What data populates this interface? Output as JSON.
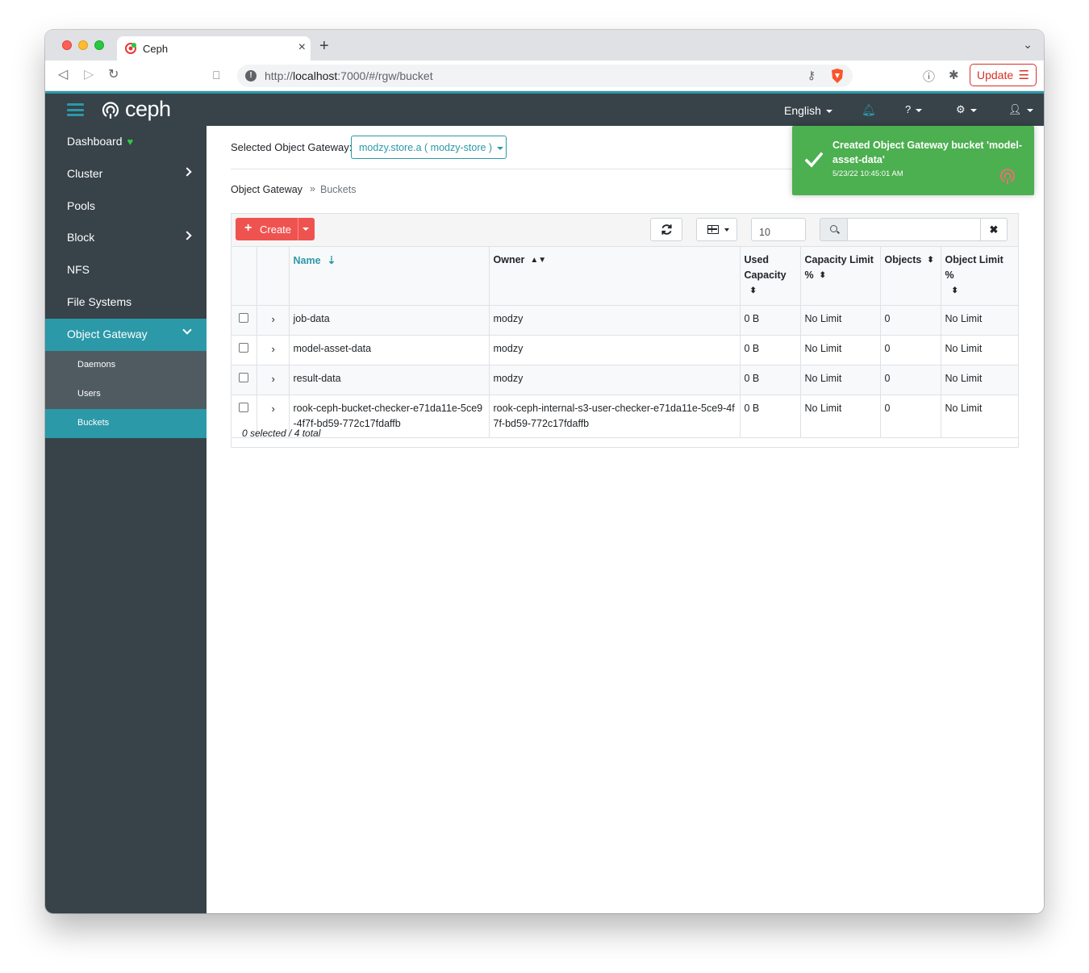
{
  "browser": {
    "tab_title": "Ceph",
    "tab_close": "×",
    "new_tab": "+",
    "tab_menu": "⌄",
    "url_prefix": "http://",
    "url_host": "localhost",
    "url_rest": ":7000/#/rgw/bucket",
    "update_label": "Update"
  },
  "navbar": {
    "brand": "ceph",
    "language": "English"
  },
  "sidebar": {
    "items": [
      {
        "label": "Dashboard"
      },
      {
        "label": "Cluster"
      },
      {
        "label": "Pools"
      },
      {
        "label": "Block"
      },
      {
        "label": "NFS"
      },
      {
        "label": "File Systems"
      },
      {
        "label": "Object Gateway"
      }
    ],
    "sub_items": [
      {
        "label": "Daemons"
      },
      {
        "label": "Users"
      },
      {
        "label": "Buckets"
      }
    ]
  },
  "gateway": {
    "label": "Selected Object Gateway:",
    "selected": "modzy.store.a ( modzy-store )"
  },
  "breadcrumb": {
    "parent": "Object Gateway",
    "separator": "»",
    "current": "Buckets"
  },
  "toolbar": {
    "create_label": "Create",
    "page_size": "10",
    "search_placeholder": "",
    "clear_label": "✖"
  },
  "table": {
    "headers": [
      "Name",
      "Owner",
      "Used Capacity",
      "Capacity Limit %",
      "Objects",
      "Object Limit %"
    ],
    "rows": [
      {
        "name": "job-data",
        "owner": "modzy",
        "used": "0 B",
        "cap_limit": "No Limit",
        "objects": "0",
        "obj_limit": "No Limit"
      },
      {
        "name": "model-asset-data",
        "owner": "modzy",
        "used": "0 B",
        "cap_limit": "No Limit",
        "objects": "0",
        "obj_limit": "No Limit"
      },
      {
        "name": "result-data",
        "owner": "modzy",
        "used": "0 B",
        "cap_limit": "No Limit",
        "objects": "0",
        "obj_limit": "No Limit"
      },
      {
        "name": "rook-ceph-bucket-checker-e71da11e-5ce9-4f7f-bd59-772c17fdaffb",
        "owner": "rook-ceph-internal-s3-user-checker-e71da11e-5ce9-4f7f-bd59-772c17fdaffb",
        "used": "0 B",
        "cap_limit": "No Limit",
        "objects": "0",
        "obj_limit": "No Limit"
      }
    ],
    "footer": "0 selected / 4 total"
  },
  "toast": {
    "title": "Created Object Gateway bucket 'model-asset-data'",
    "time": "5/23/22 10:45:01 AM"
  },
  "colors": {
    "accent": "#2b99a8",
    "nav_bg": "#374249",
    "create": "#ef5350",
    "toast": "#4caf50"
  }
}
